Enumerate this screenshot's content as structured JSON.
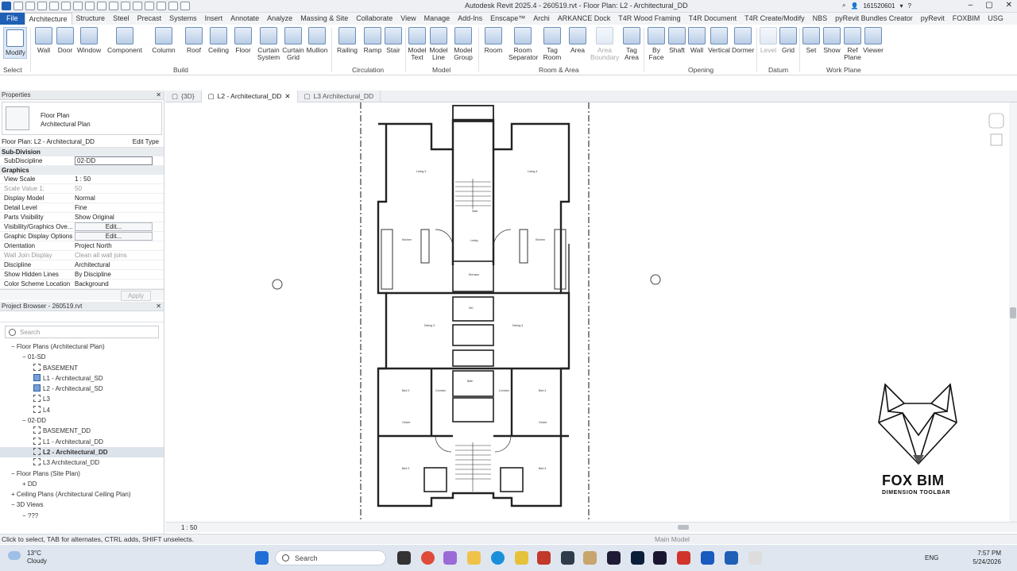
{
  "window": {
    "title": "Autodesk Revit 2025.4 - 260519.rvt - Floor Plan: L2 - Architectural_DD",
    "user": "161520601"
  },
  "ribbon_tabs": [
    "File",
    "Architecture",
    "Structure",
    "Steel",
    "Precast",
    "Systems",
    "Insert",
    "Annotate",
    "Analyze",
    "Massing & Site",
    "Collaborate",
    "View",
    "Manage",
    "Add-Ins",
    "Enscape™",
    "Archi",
    "ARKANCE Dock",
    "T4R Wood Framing",
    "T4R Document",
    "T4R Create/Modify",
    "NBS",
    "pyRevit Bundles Creator",
    "pyRevit",
    "FOXBIM",
    "USG"
  ],
  "active_tab": "Architecture",
  "tools": {
    "modify": "Modify",
    "select": "Select",
    "wall": "Wall",
    "door": "Door",
    "window": "Window",
    "component": "Component",
    "column": "Column",
    "roof": "Roof",
    "ceiling": "Ceiling",
    "floor": "Floor",
    "curtain_system": "Curtain System",
    "curtain_grid": "Curtain Grid",
    "mullion": "Mullion",
    "railing": "Railing",
    "ramp": "Ramp",
    "stair": "Stair",
    "model_text": "Model Text",
    "model_line": "Model Line",
    "model_group": "Model Group",
    "room": "Room",
    "room_separator": "Room Separator",
    "tag_room": "Tag Room",
    "area": "Area",
    "area_boundary": "Area Boundary",
    "tag_area": "Tag Area",
    "by_face": "By Face",
    "shaft": "Shaft",
    "wall_open": "Wall",
    "vertical": "Vertical",
    "dormer": "Dormer",
    "level": "Level",
    "grid": "Grid",
    "set": "Set",
    "show": "Show",
    "ref_plane": "Ref Plane",
    "viewer": "Viewer"
  },
  "groups": {
    "build": "Build",
    "circulation": "Circulation",
    "model": "Model",
    "room_area": "Room & Area",
    "opening": "Opening",
    "datum": "Datum",
    "work_plane": "Work Plane"
  },
  "view_tabs": [
    "{3D}",
    "L2 - Architectural_DD",
    "L3 Architectural_DD"
  ],
  "properties": {
    "header": "Properties",
    "type_1": "Floor Plan",
    "type_2": "Architectural Plan",
    "selector": "Floor Plan: L2 - Architectural_DD",
    "edit_type": "Edit Type",
    "section_sub": "Sub-Division",
    "section_graphics": "Graphics",
    "apply": "Apply",
    "rows": [
      {
        "k": "SubDiscipline",
        "v": "02-DD",
        "style": "input"
      },
      {
        "k": "View Scale",
        "v": "1 : 50",
        "style": "plain"
      },
      {
        "k": "Scale Value    1:",
        "v": "50",
        "style": "dis"
      },
      {
        "k": "Display Model",
        "v": "Normal",
        "style": "plain"
      },
      {
        "k": "Detail Level",
        "v": "Fine",
        "style": "plain"
      },
      {
        "k": "Parts Visibility",
        "v": "Show Original",
        "style": "plain"
      },
      {
        "k": "Visibility/Graphics Ove...",
        "v": "Edit...",
        "style": "btn"
      },
      {
        "k": "Graphic Display Options",
        "v": "Edit...",
        "style": "btn"
      },
      {
        "k": "Orientation",
        "v": "Project North",
        "style": "plain"
      },
      {
        "k": "Wall Join Display",
        "v": "Clean all wall joins",
        "style": "dis"
      },
      {
        "k": "Discipline",
        "v": "Architectural",
        "style": "plain"
      },
      {
        "k": "Show Hidden Lines",
        "v": "By Discipline",
        "style": "plain"
      },
      {
        "k": "Color Scheme Location",
        "v": "Background",
        "style": "plain"
      }
    ]
  },
  "browser": {
    "header": "Project Browser - 260519.rvt",
    "search": "Search",
    "rows": [
      {
        "t": "Floor Plans (Architectural Plan)",
        "lvl": 0,
        "pre": "−"
      },
      {
        "t": "01-SD",
        "lvl": 1,
        "pre": "−"
      },
      {
        "t": "BASEMENT",
        "lvl": 2,
        "ic": "v"
      },
      {
        "t": "L1 - Architectural_SD",
        "lvl": 2,
        "ic": "on"
      },
      {
        "t": "L2 - Architectural_SD",
        "lvl": 2,
        "ic": "on"
      },
      {
        "t": "L3",
        "lvl": 2,
        "ic": "v"
      },
      {
        "t": "L4",
        "lvl": 2,
        "ic": "v"
      },
      {
        "t": "02-DD",
        "lvl": 1,
        "pre": "−"
      },
      {
        "t": "BASEMENT_DD",
        "lvl": 2,
        "ic": "v"
      },
      {
        "t": "L1 - Architectural_DD",
        "lvl": 2,
        "ic": "v"
      },
      {
        "t": "L2 - Architectural_DD",
        "lvl": 2,
        "ic": "v",
        "sel": true
      },
      {
        "t": "L3 Architectural_DD",
        "lvl": 2,
        "ic": "v"
      },
      {
        "t": "Floor Plans (Site Plan)",
        "lvl": 0,
        "pre": "−"
      },
      {
        "t": "DD",
        "lvl": 1,
        "pre": "+"
      },
      {
        "t": "Ceiling Plans (Architectural Ceiling Plan)",
        "lvl": 0,
        "pre": "+"
      },
      {
        "t": "3D Views",
        "lvl": 0,
        "pre": "−"
      },
      {
        "t": "???",
        "lvl": 1,
        "pre": "−"
      }
    ]
  },
  "canvas": {
    "scale": "1 : 50"
  },
  "plan_labels": [
    "Living 3",
    "Living 4",
    "Kitchen",
    "Kitchen",
    "Lobby",
    "Stair",
    "Elevator",
    "Dining 3",
    "Dining 4",
    "Bed 3",
    "Bed 4",
    "Bed 3",
    "Bed 4",
    "Corridor",
    "Corridor",
    "Closet",
    "Closet",
    "WC",
    "Bath"
  ],
  "logo": {
    "name": "FOX BIM",
    "tagline": "DIMENSION TOOLBAR"
  },
  "status": {
    "hint": "Click to select, TAB for alternates, CTRL adds, SHIFT unselects.",
    "mode": "Main Model"
  },
  "taskbar": {
    "temp": "13°C",
    "weather": "Cloudy",
    "search": "Search",
    "lang": "ENG",
    "time": "7:57 PM",
    "date": "5/24/2026"
  },
  "colors": {
    "accent": "#1f5fb5",
    "ribbon_icon": "#6d8fb8",
    "plan_wall": "#222222"
  }
}
